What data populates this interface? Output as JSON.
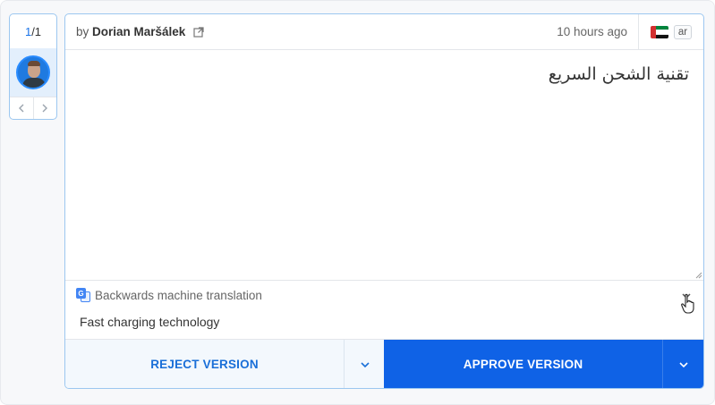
{
  "pager": {
    "current": "1",
    "total": "/1",
    "prev_icon": "chevron-left-icon",
    "next_icon": "chevron-right-icon"
  },
  "header": {
    "by_prefix": "by ",
    "author": "Dorian Maršálek",
    "external_icon": "external-link-icon",
    "time": "10 hours ago",
    "flag": "uae-flag-icon",
    "lang_code": "ar"
  },
  "translation": {
    "text": "تقنية الشحن السريع"
  },
  "backtranslation": {
    "icon": "google-translate-icon",
    "label": "Backwards machine translation",
    "text": "Fast charging technology"
  },
  "actions": {
    "reject_label": "REJECT VERSION",
    "approve_label": "APPROVE VERSION"
  },
  "colors": {
    "accent": "#0f62e6",
    "reject_text": "#1a6fd8",
    "border": "#9cc7f0"
  }
}
